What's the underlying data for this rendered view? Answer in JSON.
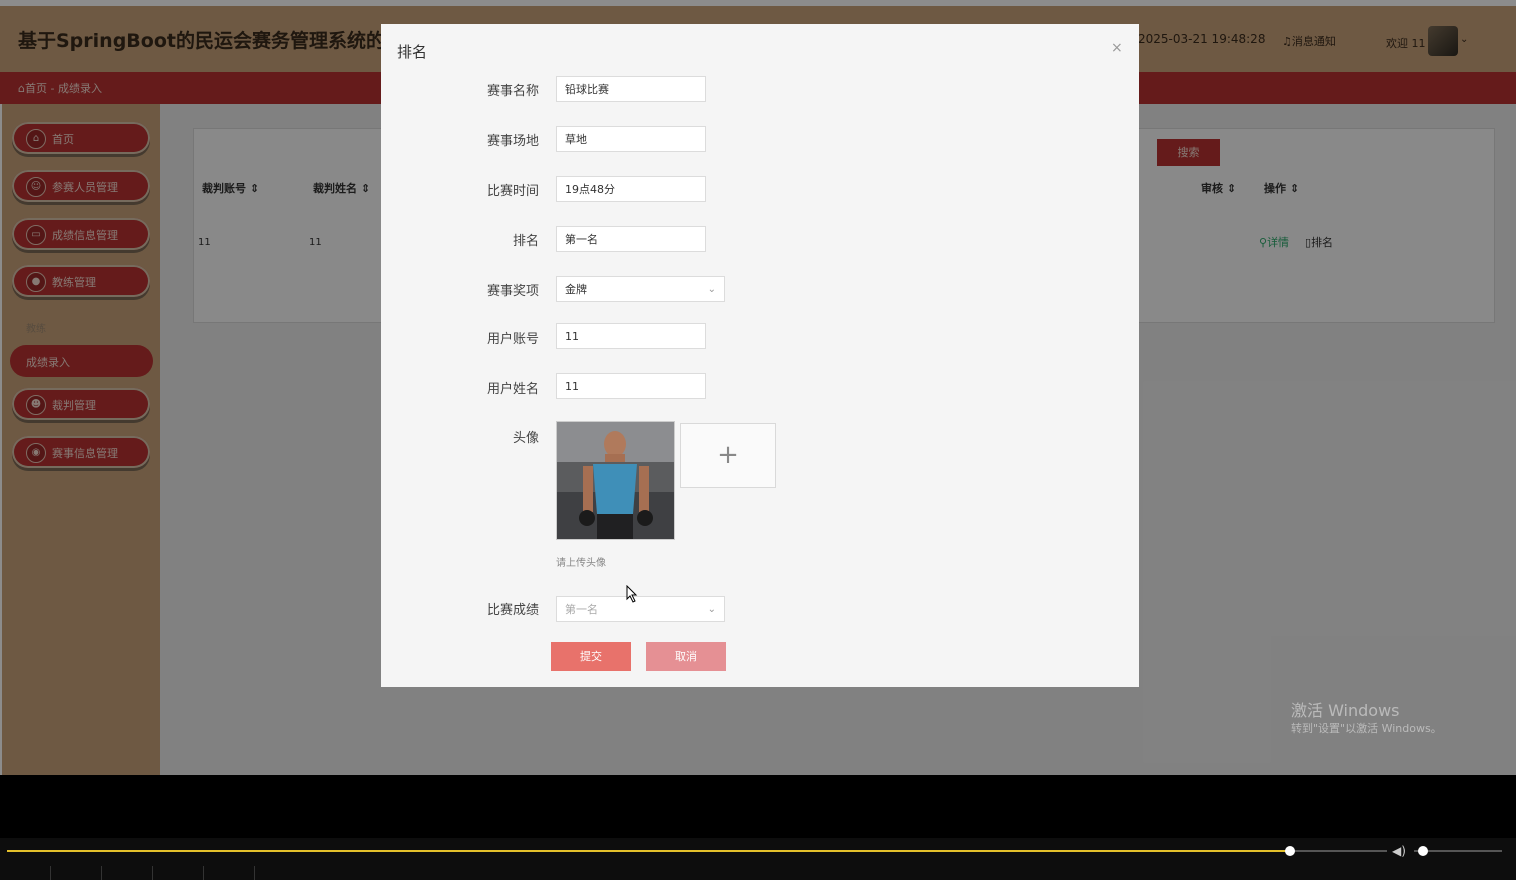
{
  "header": {
    "title": "基于SpringBoot的民运会赛务管理系统的设",
    "datetime": "2025-03-21 19:48:28",
    "notice": "消息通知",
    "welcome": "欢迎 11"
  },
  "breadcrumb": {
    "home": "首页",
    "separator": "-",
    "current": "成绩录入"
  },
  "sidebar": {
    "items": [
      {
        "label": "首页",
        "icon": "home-icon"
      },
      {
        "label": "参赛人员管理",
        "icon": "user-icon"
      },
      {
        "label": "成绩信息管理",
        "icon": "document-icon"
      },
      {
        "label": "教练管理",
        "icon": "person-icon"
      }
    ],
    "group": "教练",
    "active": "成绩录入",
    "items2": [
      {
        "label": "裁判管理",
        "icon": "person-icon"
      },
      {
        "label": "赛事信息管理",
        "icon": "trophy-icon"
      }
    ]
  },
  "main": {
    "search_label": "搜索",
    "table": {
      "columns": [
        "裁判账号",
        "裁判姓名",
        "审核",
        "操作"
      ],
      "row": {
        "account": "11",
        "name": "11"
      },
      "actions": {
        "detail": "详情",
        "rank": "排名"
      }
    }
  },
  "modal": {
    "title": "排名",
    "close": "×",
    "fields": {
      "event_name": {
        "label": "赛事名称",
        "value": "铅球比赛"
      },
      "venue": {
        "label": "赛事场地",
        "value": "草地"
      },
      "time": {
        "label": "比赛时间",
        "value": "19点48分"
      },
      "rank": {
        "label": "排名",
        "value": "第一名"
      },
      "award": {
        "label": "赛事奖项",
        "value": "金牌"
      },
      "account": {
        "label": "用户账号",
        "value": "11"
      },
      "username": {
        "label": "用户姓名",
        "value": "11"
      },
      "avatar": {
        "label": "头像",
        "tip": "请上传头像"
      },
      "score": {
        "label": "比赛成绩",
        "value": "第一名"
      }
    },
    "submit": "提交",
    "cancel": "取消"
  },
  "watermark": {
    "line1": "激活 Windows",
    "line2": "转到\"设置\"以激活 Windows。"
  },
  "player": {
    "progress": 0.93,
    "volume": 0.1
  },
  "colors": {
    "header": "#c8a27b",
    "accent": "#b83232",
    "submit": "#e8726b",
    "cancel": "#e59094"
  }
}
